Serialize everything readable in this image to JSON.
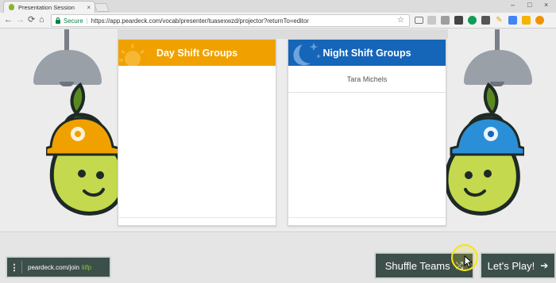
{
  "browser": {
    "tab_title": "Presentation Session",
    "tab_close": "×",
    "window_controls": [
      "–",
      "□",
      "×"
    ],
    "nav": {
      "back": "←",
      "forward": "→",
      "reload": "⟳",
      "home": "⌂"
    },
    "secure_label": "Secure",
    "separator": "|",
    "url": "https://app.peardeck.com/vocab/presenter/tuasexwzd/projector?returnTo=editor",
    "extension_icons": [
      "cast-icon",
      "extension-icon",
      "extension-icon",
      "extension-icon",
      "extension-icon",
      "extension-icon",
      "pencil-icon",
      "extension-icon",
      "folder-icon",
      "extension-icon"
    ],
    "bookmark_icon": "☆"
  },
  "groups": {
    "day": {
      "title": "Day Shift Groups",
      "color": "#f0a100",
      "members": []
    },
    "night": {
      "title": "Night Shift Groups",
      "color": "#1565b8",
      "members": [
        "Tara Michels"
      ]
    }
  },
  "footer": {
    "join_menu_icon": "⋮",
    "join_url": "peardeck.com/join",
    "join_code": "liifp",
    "shuffle_label": "Shuffle Teams",
    "shuffle_icon": "⤮",
    "play_label": "Let's Play!",
    "play_icon": "➔"
  },
  "colors": {
    "pear": "#c4d94d",
    "pear_outline": "#1e2a25",
    "leaf": "#5a8a1f",
    "accent_green": "#8bc34a",
    "button_bg": "#3d4f4a"
  }
}
